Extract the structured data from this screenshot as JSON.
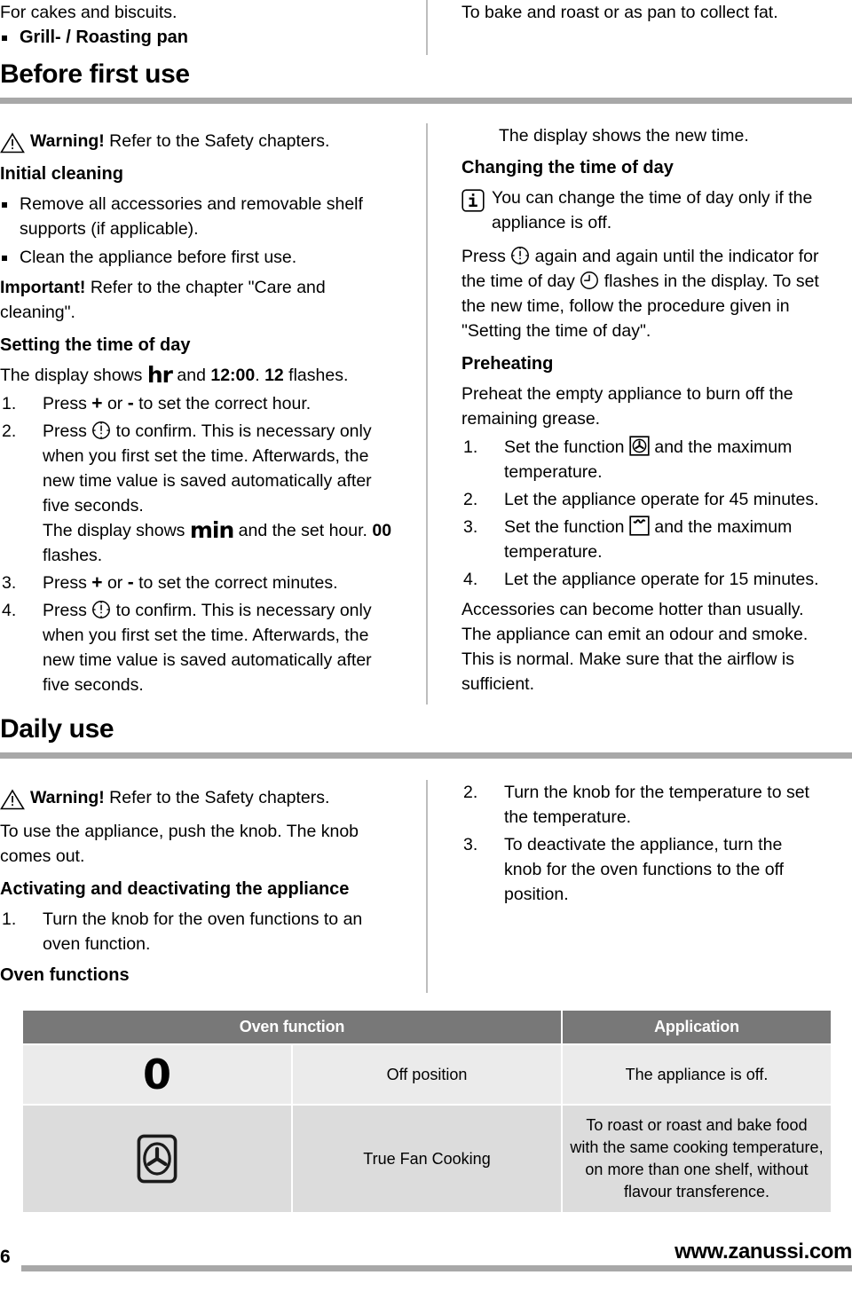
{
  "top_section": {
    "left": {
      "lead_text": "For cakes and biscuits.",
      "bullet": "Grill- / Roasting pan"
    },
    "right": {
      "text": "To bake and roast or as pan to collect fat."
    },
    "chapter_title": "Before first use"
  },
  "before_first_use": {
    "left": {
      "warning_label": "Warning!",
      "warning_text": " Refer to the Safety chapters.",
      "initial_cleaning_heading": "Initial cleaning",
      "initial_cleaning_bullets": [
        "Remove all accessories and removable shelf supports (if applicable).",
        "Clean the appliance before first use."
      ],
      "important_label": "Important!",
      "important_text": " Refer to the chapter \"Care and cleaning\".",
      "setting_time_heading": "Setting the time of day",
      "display_line_pre": "The display shows ",
      "display_line_lcd": "hr",
      "display_line_mid": " and ",
      "display_line_time": "12:00",
      "display_line_post": ". ",
      "display_line_flash_num": "12",
      "display_line_flash_text": " flashes.",
      "steps": [
        {
          "pre": "Press ",
          "plus": "+",
          "mid": " or ",
          "minus": "-",
          "post": " to set the correct hour."
        },
        {
          "pre": "Press ",
          "icon": "clock-confirm-icon",
          "post": " to confirm. This is necessary only when you first set the time. Afterwards, the new time value is saved automatically after five seconds.",
          "sub_pre": "The display shows ",
          "sub_lcd": "min",
          "sub_mid": " and the set hour. ",
          "sub_flash_num": "00",
          "sub_flash_text": " flashes."
        },
        {
          "pre": "Press ",
          "plus": "+",
          "mid": " or ",
          "minus": "-",
          "post": " to set the correct minutes."
        },
        {
          "pre": "Press ",
          "icon": "clock-confirm-icon",
          "post": " to confirm. This is necessary only when you first set the time. Afterwards, the new time value is saved automatically after five seconds."
        }
      ]
    },
    "right": {
      "display_new_time": "The display shows the new time.",
      "changing_time_heading": "Changing the time of day",
      "info_text": "You can change the time of day only if the appliance is off.",
      "press_pre": "Press ",
      "press_mid": " again and again until the indicator for the time of day ",
      "press_post": " flashes in the display. To set the new time, follow the procedure given in \"Setting the time of day\".",
      "preheating_heading": "Preheating",
      "preheating_intro": "Preheat the empty appliance to burn off the remaining grease.",
      "preheating_steps": [
        {
          "pre": "Set the function ",
          "icon": "true-fan-cooking-icon",
          "post": " and the maximum temperature."
        },
        {
          "pre": "Let the appliance operate for 45 minutes.",
          "icon": "",
          "post": ""
        },
        {
          "pre": "Set the function ",
          "icon": "top-heat-icon",
          "post": " and the maximum temperature."
        },
        {
          "pre": "Let the appliance operate for 15 minutes.",
          "icon": "",
          "post": ""
        }
      ],
      "closing_text": "Accessories can become hotter than usually. The appliance can emit an odour and smoke. This is normal. Make sure that the airflow is sufficient."
    }
  },
  "daily_use": {
    "chapter_title": "Daily use",
    "left": {
      "warning_label": "Warning!",
      "warning_text": " Refer to the Safety chapters.",
      "intro": "To use the appliance, push the knob. The knob comes out.",
      "activating_heading": "Activating and deactivating the appliance",
      "step1": "Turn the knob for the oven functions to an oven function.",
      "oven_functions_heading": "Oven functions"
    },
    "right": {
      "step2": "Turn the knob for the temperature to set the temperature.",
      "step3": "To deactivate the appliance, turn the knob for the oven functions to the off position."
    }
  },
  "oven_functions_table": {
    "headers": [
      "Oven function",
      "Application"
    ],
    "rows": [
      {
        "symbol": "zero-symbol",
        "name": "Off position",
        "application": "The appliance is off."
      },
      {
        "symbol": "true-fan-cooking-icon",
        "name": "True Fan Cooking",
        "application": "To roast or roast and bake food with the same cooking temperature, on more than one shelf, without flavour transference."
      }
    ]
  },
  "footer": {
    "page_number": "6",
    "url": "www.zanussi.com"
  },
  "colors": {
    "rule_grey": "#a8a8a8",
    "table_header_bg": "#787878",
    "row_light": "#ebebeb",
    "row_dark": "#dcdcdc",
    "divider": "#bdbdbd"
  }
}
